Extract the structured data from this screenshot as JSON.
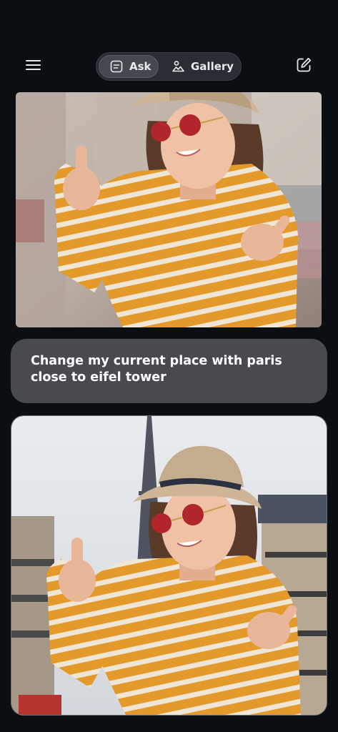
{
  "header": {
    "menu_icon": "hamburger-menu-icon",
    "tabs": [
      {
        "label": "Ask",
        "icon": "chat-note-icon",
        "selected": true
      },
      {
        "label": "Gallery",
        "icon": "image-gallery-icon",
        "selected": false
      }
    ],
    "compose_icon": "edit-compose-icon"
  },
  "conversation": {
    "user_image": {
      "kind": "photo",
      "subject": "woman-thumbs-up-city"
    },
    "user_prompt": "Change my current place with paris close to eifel tower",
    "result_image": {
      "kind": "photo",
      "subject": "woman-thumbs-up-paris-eiffel-tower"
    }
  },
  "colors": {
    "background": "#0b0e13",
    "bubble": "#484a50",
    "segment_bg": "#2a2d33",
    "segment_selected": "#45484f",
    "sweater_orange": "#e39a2a",
    "sweater_cream": "#efe6d6"
  }
}
